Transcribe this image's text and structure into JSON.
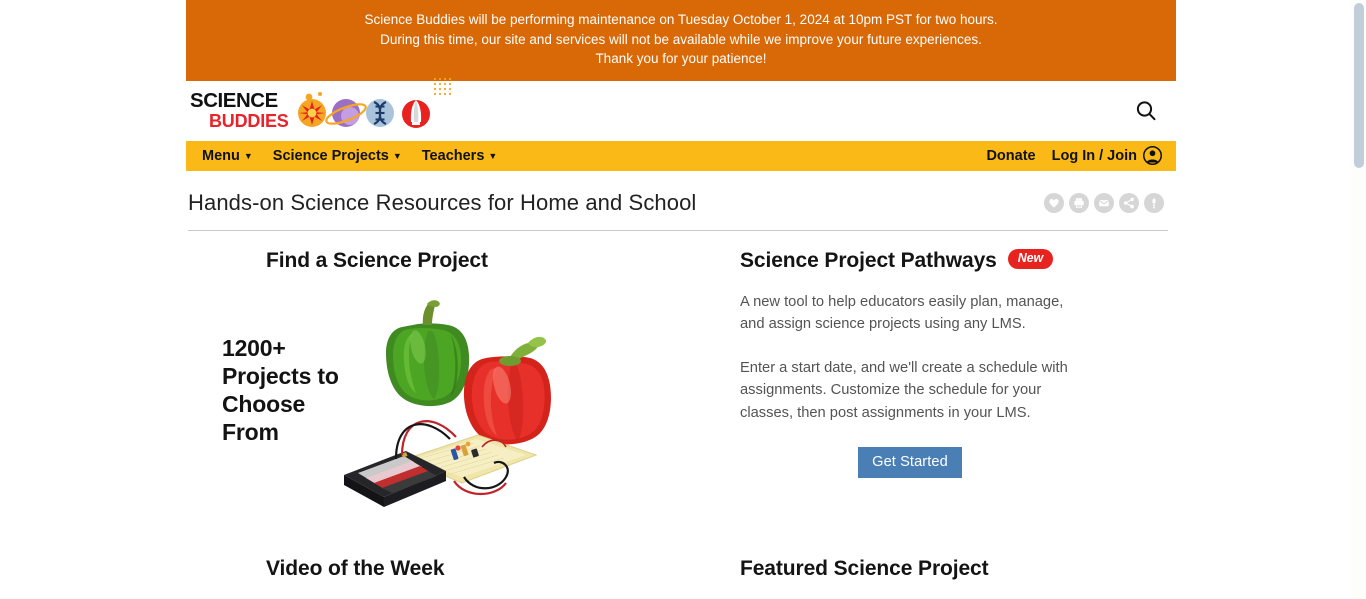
{
  "banner": {
    "line1": "Science Buddies will be performing maintenance on Tuesday October 1, 2024 at 10pm PST for two hours.",
    "line2": "During this time, our site and services will not be available while we improve your future experiences.",
    "line3": "Thank you for your patience!",
    "bg_color": "#d96806"
  },
  "header": {
    "logo_line1": "SCIENCE",
    "logo_line2": "BUDDIES",
    "logo_icons": [
      "sun-star-icon",
      "planet-icon",
      "dna-icon",
      "rocket-icon"
    ],
    "search_icon": "search-icon"
  },
  "nav": {
    "bg_color": "#fbb918",
    "left_items": [
      {
        "label": "Menu",
        "has_chevron": true
      },
      {
        "label": "Science Projects",
        "has_chevron": true
      },
      {
        "label": "Teachers",
        "has_chevron": true
      }
    ],
    "right_items": [
      {
        "label": "Donate",
        "has_chevron": false
      },
      {
        "label": "Log In / Join",
        "has_chevron": false
      }
    ],
    "avatar_icon": "user-avatar-icon"
  },
  "page_title": "Hands-on Science Resources for Home and School",
  "title_actions": [
    {
      "icon": "heart-icon",
      "label": "Favorite"
    },
    {
      "icon": "printer-icon",
      "label": "Print"
    },
    {
      "icon": "envelope-icon",
      "label": "Email"
    },
    {
      "icon": "share-icon",
      "label": "Share"
    },
    {
      "icon": "more-info-icon",
      "label": "More"
    }
  ],
  "left_column": {
    "heading": "Find a Science Project",
    "hero_text_lines": [
      "1200+",
      "Projects to",
      "Choose",
      "From"
    ],
    "hero_image_alt": "bell-peppers-battery-breadboard-circuit"
  },
  "right_column": {
    "heading": "Science Project Pathways",
    "badge": "New",
    "badge_color": "#e8231f",
    "paragraph1": "A new tool to help educators easily plan, manage, and assign science projects using any LMS.",
    "paragraph2": "Enter a start date, and we'll create a schedule with assignments. Customize the schedule for your classes, then post assignments in your LMS.",
    "button_label": "Get Started",
    "button_color": "#4a7fb5"
  },
  "bottom": {
    "left_heading": "Video of the Week",
    "right_heading": "Featured Science Project"
  },
  "scrollbar": {
    "thumb_color": "#c2cdda"
  }
}
